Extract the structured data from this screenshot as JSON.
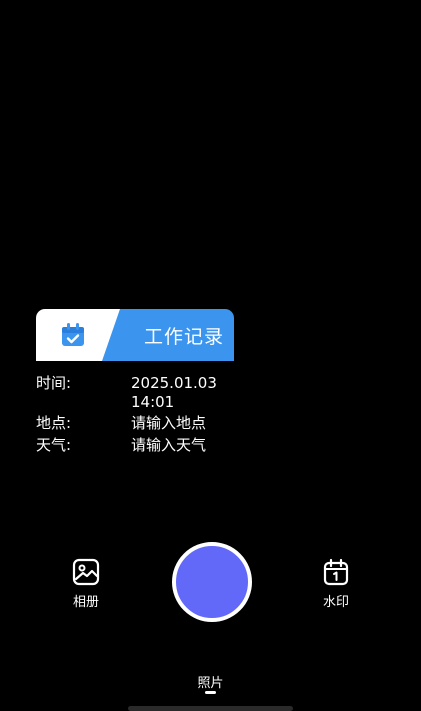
{
  "colors": {
    "background": "#000000",
    "watermark_blue": "#3b95ee",
    "shutter_fill": "#6268f7",
    "text": "#ffffff"
  },
  "watermark": {
    "icon": "calendar-check-icon",
    "title": "工作记录",
    "rows": [
      {
        "label": "时间:",
        "value": "2025.01.03 14:01"
      },
      {
        "label": "地点:",
        "value": "请输入地点"
      },
      {
        "label": "天气:",
        "value": "请输入天气"
      }
    ]
  },
  "controls": {
    "album": {
      "icon": "image-icon",
      "label": "相册"
    },
    "watermark": {
      "icon": "calendar-icon",
      "label": "水印"
    },
    "shutter": {
      "icon": "shutter-button"
    }
  },
  "mode": {
    "label": "照片"
  }
}
